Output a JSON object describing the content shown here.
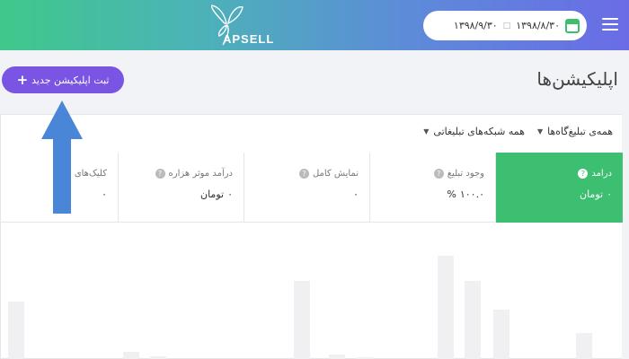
{
  "header": {
    "brand": "APSELL",
    "date_from": "۱۳۹۸/۸/۳۰",
    "date_to": "۱۳۹۸/۹/۳۰",
    "date_separator": "□",
    "menu_icon": "hamburger-icon",
    "calendar_icon": "calendar-icon"
  },
  "page": {
    "title": "اپلیکیشن‌ها",
    "new_app_button": "ثبت اپلیکیشن جدید",
    "new_app_plus": "+"
  },
  "filters": {
    "placements": "همه‌ی تبلیغ‌گاه‌ها",
    "networks": "همه شبکه‌های تبلیغاتی"
  },
  "metrics": [
    {
      "label": "درامد",
      "value": "۰",
      "unit": "تومان",
      "active": true
    },
    {
      "label": "وجود تبلیغ",
      "value": "۱۰۰.۰",
      "unit": "%"
    },
    {
      "label": "نمایش کامل",
      "value": "۰",
      "unit": ""
    },
    {
      "label": "درآمد موثر هزاره",
      "value": "۰",
      "unit": "تومان"
    },
    {
      "label": "کلیک‌های",
      "value": "۰",
      "unit": ""
    }
  ],
  "colors": {
    "accent_green": "#3cbf70",
    "button_purple": "#7a55e3",
    "arrow_blue": "#4a86d8"
  }
}
